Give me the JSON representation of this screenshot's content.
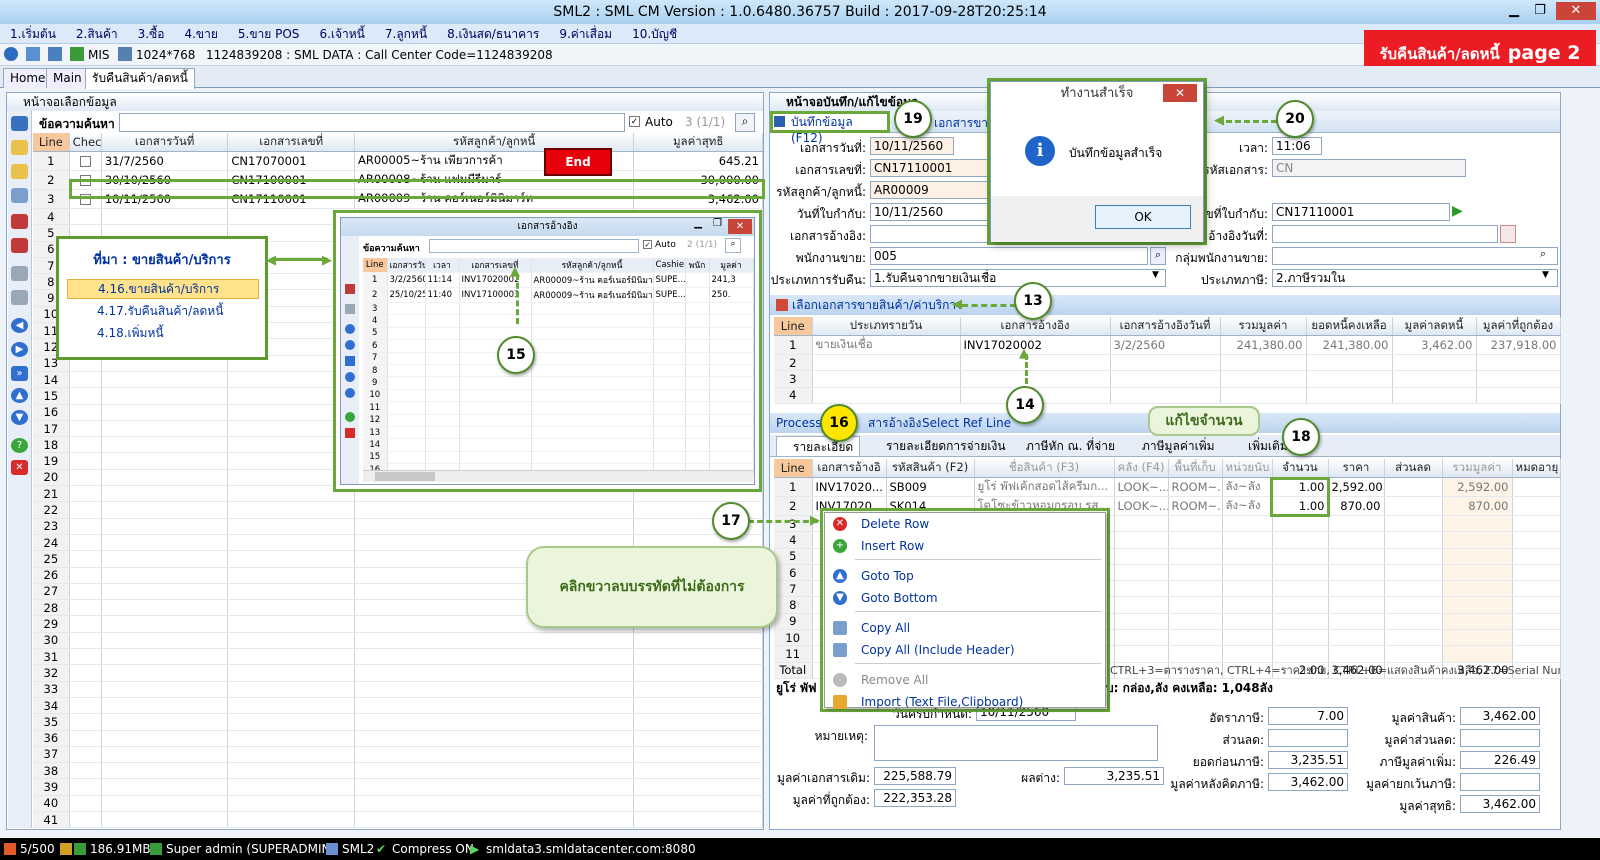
{
  "window": {
    "title": "SML2 : SML CM Version : 1.0.6480.36757  Build : 2017-09-28T20:25:14"
  },
  "menu": [
    "1.เริ่มต้น",
    "2.สินค้า",
    "3.ซื้อ",
    "4.ขาย",
    "5.ขาย POS",
    "6.เจ้าหนี้",
    "7.ลูกหนี้",
    "8.เงินสด/ธนาคาร",
    "9.ค่าเสื่อม",
    "10.บัญชี"
  ],
  "toolbar": {
    "mis": "MIS",
    "resolution": "1024*768",
    "info": "1124839208 : SML DATA : Call Center Code=1124839208"
  },
  "tabs": [
    "Home",
    "Main",
    "รับคืนสินค้า/ลดหนี้"
  ],
  "banner": {
    "text": "รับคืนสินค้า/ลดหนี้",
    "page": "page 2"
  },
  "left_panel": {
    "title": "หน้าจอเลือกข้อมูล",
    "search_label": "ข้อความค้นหา",
    "auto_label": "Auto",
    "count": "3 (1/1)",
    "columns": [
      "Line",
      "Check",
      "เอกสารวันที่",
      "เอกสารเลขที่",
      "รหัสลูกค้า/ลูกหนี้",
      "มูลค่าสุทธิ"
    ],
    "rows": [
      {
        "line": "1",
        "date": "31/7/2560",
        "doc": "CN17070001",
        "cust": "AR00005~ร้าน เพียวการค้า",
        "amount": "645.21"
      },
      {
        "line": "2",
        "date": "30/10/2560",
        "doc": "CN17100001",
        "cust": "AR00008~ร้าน แฟมมีรีมาร์",
        "amount": "30,000.00"
      },
      {
        "line": "3",
        "date": "10/11/2560",
        "doc": "CN17110001",
        "cust": "AR00009~ร้าน คอร์เนอร์มินิมาร์ท",
        "amount": "3,462.00"
      }
    ],
    "total_lines": 41,
    "end_button": "End"
  },
  "source_callout": {
    "title": "ที่มา : ขายสินค้า/บริการ",
    "items": [
      "4.16.ขายสินค้า/บริการ",
      "4.17.รับคืนสินค้า/ลดหนี้",
      "4.18.เพิ่มหนี้"
    ]
  },
  "ref_window": {
    "title": "เอกสารอ้างอิง",
    "search_label": "ข้อความค้นหา",
    "auto_label": "Auto",
    "count": "2 (1/1)",
    "columns": [
      "Line",
      "เอกสารวันที่",
      "เวลา",
      "เอกสารเลขที่",
      "รหัสลูกค้า/ลูกหนี้",
      "Cashie",
      "พนัก",
      "มูลค่า"
    ],
    "rows": [
      {
        "line": "1",
        "date": "3/2/2560",
        "time": "11:14",
        "doc": "INV17020002",
        "cust": "AR00009~ร้าน คอร์เนอร์มินิมาร์...",
        "cashier": "SUPE...",
        "emp": "",
        "amount": "241,3"
      },
      {
        "line": "2",
        "date": "25/10/25...",
        "time": "11:40",
        "doc": "INV17100003",
        "cust": "AR00009~ร้าน คอร์เนอร์มินิมาร์...",
        "cashier": "SUPE...",
        "emp": "",
        "amount": "250."
      }
    ],
    "total_lines": 16
  },
  "right_panel": {
    "title": "หน้าจอบันทึก/แก้ไขข้อมูล",
    "save_button": "บันทึกข้อมูล (F12)",
    "ref_tab": "เอกสารขาย",
    "form": {
      "doc_date_label": "เอกสารวันที่:",
      "doc_date": "10/11/2560",
      "doc_no_label": "เอกสารเลขที่:",
      "doc_no": "CN17110001",
      "cust_label": "รหัสลูกค้า/ลูกหนี้:",
      "cust": "AR00009",
      "tax_date_label": "วันที่ใบกำกับ:",
      "tax_date": "10/11/2560",
      "ref_doc_label": "เอกสารอ้างอิง:",
      "ref_doc": "",
      "emp_label": "พนักงานขาย:",
      "emp": "005",
      "return_type_label": "ประเภทการรับคืน:",
      "return_type": "1.รับคืนจากขายเงินเชื่อ",
      "time_label": "เวลา:",
      "time": "11:06",
      "doc_code_label": "รหัสเอกสาร:",
      "doc_code": "CN",
      "tax_no_label": "ขที่ใบกำกับ:",
      "tax_no": "CN17110001",
      "ref_date_label": "อ้างอิงวันที่:",
      "ref_date": "",
      "emp_group_label": "กลุ่มพนักงานขาย:",
      "emp_group": "",
      "tax_type_label": "ประเภทภาษี:",
      "tax_type": "2.ภาษีรวมใน"
    },
    "ref_strip": "เลือกเอกสารขายสินค้า/ค่าบริการ",
    "ref_columns": [
      "Line",
      "ประเภทรายวัน",
      "เอกสารอ้างอิง",
      "เอกสารอ้างอิงวันที่",
      "รวมมูลค่า",
      "ยอดหนี้คงเหลือ",
      "มูลค่าลดหนี้",
      "มูลค่าที่ถูกต้อง"
    ],
    "ref_rows": [
      {
        "line": "1",
        "type": "ขายเงินเชื่อ",
        "doc": "INV17020002",
        "date": "3/2/2560",
        "total": "241,380.00",
        "balance": "241,380.00",
        "credit": "3,462.00",
        "correct": "237,918.00"
      }
    ],
    "ref_lines": 4,
    "process_strip": {
      "process": "Process",
      "ref_doc": "สารอ้างอิง",
      "select": "Select Ref Line"
    },
    "detail_tabs": [
      "รายละเอียด",
      "รายละเอียดการจ่ายเงิน",
      "ภาษีหัก ณ. ที่จ่าย",
      "ภาษีมูลค่าเพิ่ม",
      "เพิ่มเติม"
    ],
    "detail_columns": [
      "Line",
      "เอกสารอ้างอิ",
      "รหัสสินค้า (F2)",
      "ชื่อสินค้า (F3)",
      "คลัง (F4)",
      "พื้นที่เก็บ",
      "หน่วยนับ",
      "จำนวน",
      "ราคา",
      "ส่วนลด",
      "รวมมูลค่า",
      "หมดอายุ"
    ],
    "detail_rows": [
      {
        "line": "1",
        "ref": "INV17020...",
        "code": "SB009",
        "name": "ยูโร่ พัฟเค้กสอดไส้ครีมก...",
        "wh": "LOOK~...",
        "loc": "ROOM~...",
        "unit": "ลัง~ลัง",
        "qty": "1.00",
        "price": "2,592.00",
        "disc": "",
        "total": "2,592.00",
        "exp": ""
      },
      {
        "line": "2",
        "ref": "INV17020...",
        "code": "SK014",
        "name": "โดโซะข้าวหอมกรอบ รส...",
        "wh": "LOOK~...",
        "loc": "ROOM~...",
        "unit": "ลัง~ลัง",
        "qty": "1.00",
        "price": "870.00",
        "disc": "",
        "total": "870.00",
        "exp": ""
      }
    ],
    "detail_lines": 11,
    "total_row": {
      "label": "Total",
      "qty": "2.00",
      "price": "3,462.00",
      "total": "3,462.00"
    },
    "hint": "CTRL+3=ตารางราคา, CTRL+4=ราคาขาย, CTRL+6=แสดงสินค้าคงเหลือ, F7=Serial Num",
    "product_line": {
      "prefix": "ยูโร่ พัฟ",
      "unit_text": "บ: กล่อง,ลัง คงเหลือ: 1,048ลัง"
    },
    "bottom": {
      "due_label": "วันครบกำหนด:",
      "due": "10/11/2560",
      "note_label": "หมายเหตุ:",
      "orig_label": "มูลค่าเอกสารเดิม:",
      "orig": "225,588.79",
      "correct_label": "มูลค่าที่ถูกต้อง:",
      "correct": "222,353.28",
      "diff_label": "ผลต่าง:",
      "diff": "3,235.51",
      "vat_rate_label": "อัตราภาษี:",
      "vat_rate": "7.00",
      "discount_label": "ส่วนลด:",
      "discount": "",
      "before_vat_label": "ยอดก่อนภาษี:",
      "before_vat": "3,235.51",
      "after_vat_label": "มูลค่าหลังคิดภาษี:",
      "after_vat": "3,462.00",
      "goods_label": "มูลค่าสินค้า:",
      "goods": "3,462.00",
      "disc_val_label": "มูลค่าส่วนลด:",
      "disc_val": "",
      "vat_label": "ภาษีมูลค่าเพิ่ม:",
      "vat": "226.49",
      "exempt_label": "มูลค่ายกเว้นภาษี:",
      "exempt": "",
      "net_label": "มูลค่าสุทธิ:",
      "net": "3,462.00"
    }
  },
  "context_menu": [
    "Delete Row",
    "Insert Row",
    "Goto Top",
    "Goto Bottom",
    "Copy All",
    "Copy All (Include Header)",
    "Remove All",
    "Import (Text File,Clipboard)"
  ],
  "right_click_callout": "คลิกขวาลบบรรทัดที่ไม่ต้องการ",
  "edit_qty_callout": "แก้ไขจำนวน",
  "dialog": {
    "title": "ทำงานสำเร็จ",
    "message": "บันทึกข้อมูลสำเร็จ",
    "ok": "OK"
  },
  "markers": [
    "13",
    "14",
    "15",
    "16",
    "17",
    "18",
    "19",
    "20"
  ],
  "statusbar": {
    "count": "5/500",
    "memory": "186.91MB",
    "user": "Super admin (SUPERADMIN)",
    "app": "SML2",
    "compress": "Compress ON",
    "server": "smldata3.smldatacenter.com:8080"
  },
  "colors": {
    "banner": "#ec1c24",
    "callout_border": "#6aa83a",
    "marker_yellow": "#ffe600"
  }
}
